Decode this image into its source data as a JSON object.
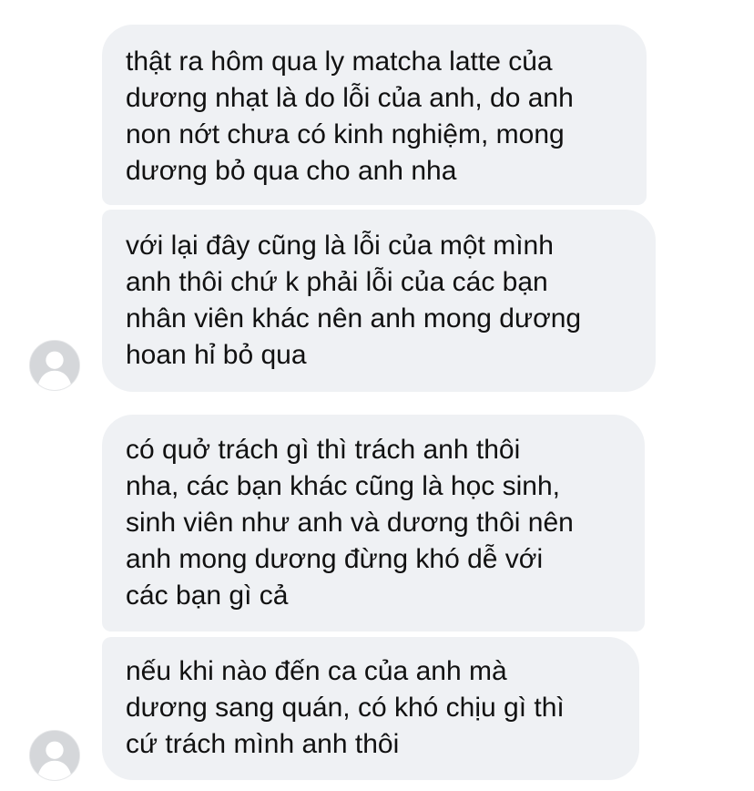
{
  "conversation": {
    "messages": [
      {
        "text": "thật ra hôm qua ly matcha latte của\ndương nhạt là do lỗi của anh, do anh\nnon nớt chưa có kinh nghiệm, mong\ndương bỏ qua cho anh nha"
      },
      {
        "text": "với lại đây cũng là lỗi của một mình\nanh thôi chứ k phải lỗi của các bạn\nnhân viên khác nên anh mong dương\nhoan hỉ bỏ qua"
      },
      {
        "text": "có quở trách gì thì trách anh thôi\nnha, các bạn khác cũng là học sinh,\nsinh viên như anh và dương thôi nên\nanh mong dương đừng khó dễ với\ncác bạn gì cả"
      },
      {
        "text": "nếu khi nào đến ca của anh mà\ndương sang quán, có khó chịu gì thì\ncứ trách mình anh thôi"
      }
    ]
  },
  "style": {
    "bubble_color": "#eff1f4",
    "text_color": "#111111",
    "avatar_color": "#d5d7da",
    "avatar_icon": "default-profile-silhouette-icon"
  }
}
